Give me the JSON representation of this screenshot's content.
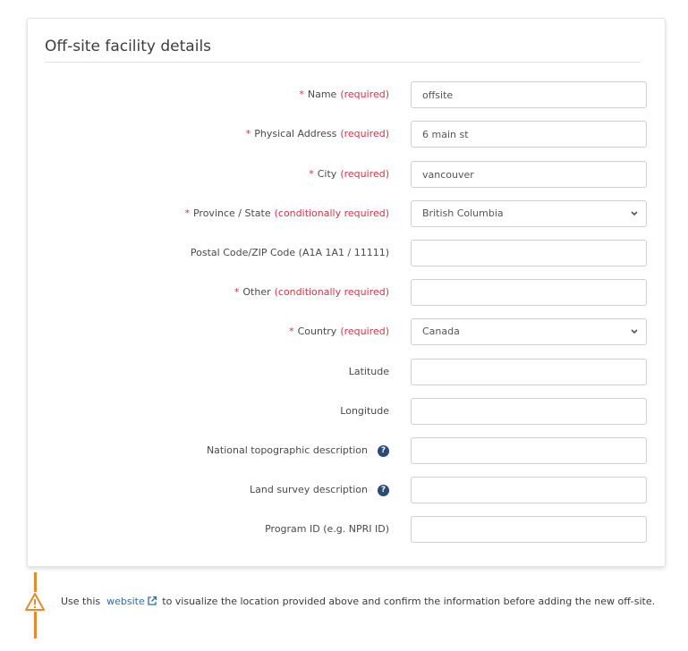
{
  "card": {
    "title": "Off-site facility details"
  },
  "fields": [
    {
      "key": "name",
      "label": "Name",
      "required_mark": "*",
      "required_text": "(required)",
      "type": "text",
      "value": "offsite"
    },
    {
      "key": "physical_address",
      "label": "Physical Address",
      "required_mark": "*",
      "required_text": "(required)",
      "type": "text",
      "value": "6 main st"
    },
    {
      "key": "city",
      "label": "City",
      "required_mark": "*",
      "required_text": "(required)",
      "type": "text",
      "value": "vancouver"
    },
    {
      "key": "province_state",
      "label": "Province / State",
      "required_mark": "*",
      "required_text": "(conditionally required)",
      "type": "select",
      "value": "British Columbia"
    },
    {
      "key": "postal_code",
      "label": "Postal Code/ZIP Code (A1A 1A1 / 11111)",
      "type": "text",
      "value": ""
    },
    {
      "key": "other",
      "label": "Other",
      "required_mark": "*",
      "required_text": "(conditionally required)",
      "type": "text",
      "value": ""
    },
    {
      "key": "country",
      "label": "Country",
      "required_mark": "*",
      "required_text": "(required)",
      "type": "select",
      "value": "Canada"
    },
    {
      "key": "latitude",
      "label": "Latitude",
      "type": "text",
      "value": ""
    },
    {
      "key": "longitude",
      "label": "Longitude",
      "type": "text",
      "value": ""
    },
    {
      "key": "national_topographic",
      "label": "National topographic description",
      "type": "text",
      "value": "",
      "info_icon": "question-circle-icon"
    },
    {
      "key": "land_survey",
      "label": "Land survey description",
      "type": "text",
      "value": "",
      "info_icon": "question-circle-icon"
    },
    {
      "key": "program_id",
      "label": "Program ID (e.g. NPRI ID)",
      "type": "text",
      "value": ""
    }
  ],
  "alert": {
    "icon": "warning-icon",
    "text_before": "Use this",
    "link_text": "website",
    "link_icon": "external-link-icon",
    "text_after": "to visualize the location provided above and confirm the information before adding the new off-site."
  },
  "colors": {
    "required": "#d1364a",
    "link": "#2f6aa6",
    "warning": "#e98a2a",
    "info_icon": "#2a4b7a"
  }
}
